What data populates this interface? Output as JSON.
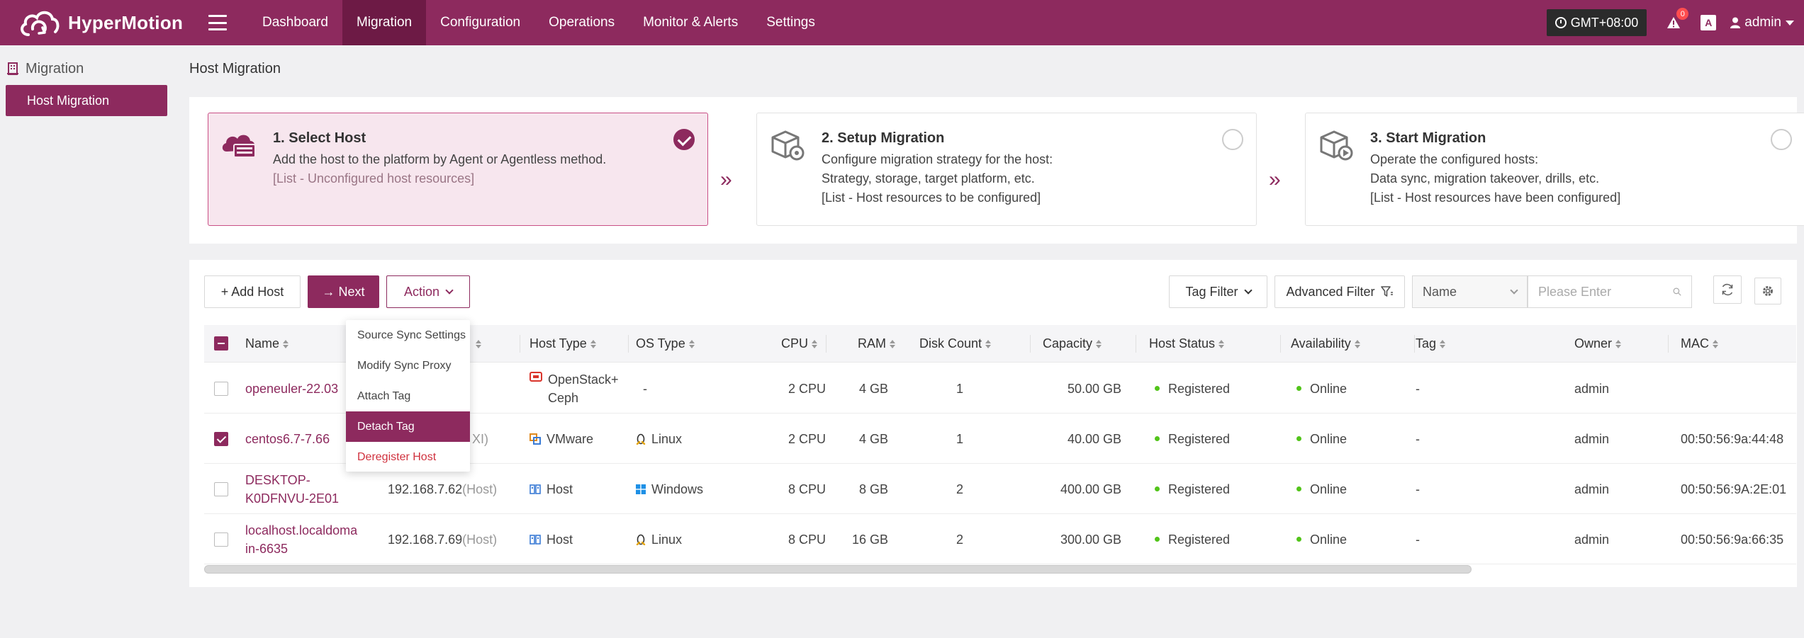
{
  "app": {
    "title": "HyperMotion"
  },
  "nav": [
    {
      "label": "Dashboard",
      "active": false
    },
    {
      "label": "Migration",
      "active": true
    },
    {
      "label": "Configuration",
      "active": false
    },
    {
      "label": "Operations",
      "active": false
    },
    {
      "label": "Monitor & Alerts",
      "active": false
    },
    {
      "label": "Settings",
      "active": false
    }
  ],
  "topbar": {
    "timezone": "GMT+08:00",
    "alert_count": "0",
    "lang_label": "A",
    "user": "admin"
  },
  "sidebar": {
    "title": "Migration",
    "items": [
      {
        "label": "Host Migration",
        "active": true
      }
    ]
  },
  "page": {
    "title": "Host Migration"
  },
  "steps": [
    {
      "title": "1. Select Host",
      "lines": [
        "Add the host to the platform by Agent or Agentless method."
      ],
      "hint": "[List - Unconfigured host resources]",
      "active": true
    },
    {
      "title": "2. Setup Migration",
      "lines": [
        "Configure migration strategy for the host:",
        "Strategy, storage, target platform, etc."
      ],
      "hint": "[List - Host resources to be configured]",
      "active": false
    },
    {
      "title": "3. Start Migration",
      "lines": [
        "Operate the configured hosts:",
        "Data sync, migration takeover, drills, etc."
      ],
      "hint": "[List - Host resources have been configured]",
      "active": false
    }
  ],
  "toolbar": {
    "add_host": "+ Add Host",
    "next": "→ Next",
    "action": "Action",
    "tag_filter": "Tag Filter",
    "advanced_filter": "Advanced Filter",
    "search_field": "Name",
    "search_placeholder": "Please Enter"
  },
  "action_menu": [
    {
      "label": "Source Sync Settings",
      "highlighted": false,
      "danger": false
    },
    {
      "label": "Modify Sync Proxy",
      "highlighted": false,
      "danger": false
    },
    {
      "label": "Attach Tag",
      "highlighted": false,
      "danger": false
    },
    {
      "label": "Detach Tag",
      "highlighted": true,
      "danger": false
    },
    {
      "label": "Deregister Host",
      "highlighted": false,
      "danger": true
    }
  ],
  "table": {
    "columns": [
      "Name",
      "Host Type",
      "OS Type",
      "CPU",
      "RAM",
      "Disk Count",
      "Capacity",
      "Host Status",
      "Availability",
      "Tag",
      "Owner",
      "MAC"
    ],
    "rows": [
      {
        "checked": false,
        "name": [
          "openeuler-22.03"
        ],
        "ip": "",
        "ip_suffix": "",
        "host_type": [
          "OpenStack+",
          "Ceph"
        ],
        "host_type_icon": "openstack-icon",
        "os": "-",
        "os_icon": "",
        "cpu": "2 CPU",
        "ram": "4 GB",
        "disk": "1",
        "capacity": "50.00 GB",
        "status": "Registered",
        "availability": "Online",
        "tag": "-",
        "owner": "admin",
        "mac": ""
      },
      {
        "checked": true,
        "name": [
          "centos6.7-7.66"
        ],
        "ip": "",
        "ip_suffix": "XI)",
        "host_type": [
          "VMware"
        ],
        "host_type_icon": "vmware-icon",
        "os": "Linux",
        "os_icon": "linux-icon",
        "cpu": "2 CPU",
        "ram": "4 GB",
        "disk": "1",
        "capacity": "40.00 GB",
        "status": "Registered",
        "availability": "Online",
        "tag": "-",
        "owner": "admin",
        "mac": "00:50:56:9a:44:48"
      },
      {
        "checked": false,
        "name": [
          "DESKTOP-",
          "K0DFNVU-2E01"
        ],
        "ip": "192.168.7.62",
        "ip_suffix": "(Host)",
        "host_type": [
          "Host"
        ],
        "host_type_icon": "host-icon",
        "os": "Windows",
        "os_icon": "windows-icon",
        "cpu": "8 CPU",
        "ram": "8 GB",
        "disk": "2",
        "capacity": "400.00 GB",
        "status": "Registered",
        "availability": "Online",
        "tag": "-",
        "owner": "admin",
        "mac": "00:50:56:9A:2E:01"
      },
      {
        "checked": false,
        "name": [
          "localhost.localdoma",
          "in-6635"
        ],
        "ip": "192.168.7.69",
        "ip_suffix": "(Host)",
        "host_type": [
          "Host"
        ],
        "host_type_icon": "host-icon",
        "os": "Linux",
        "os_icon": "linux-icon",
        "cpu": "8 CPU",
        "ram": "16 GB",
        "disk": "2",
        "capacity": "300.00 GB",
        "status": "Registered",
        "availability": "Online",
        "tag": "-",
        "owner": "admin",
        "mac": "00:50:56:9a:66:35"
      }
    ]
  },
  "colors": {
    "brand": "#8d2a5e",
    "brand_dark": "#6d1a45",
    "online": "#52c41a",
    "danger": "#d0313e"
  }
}
